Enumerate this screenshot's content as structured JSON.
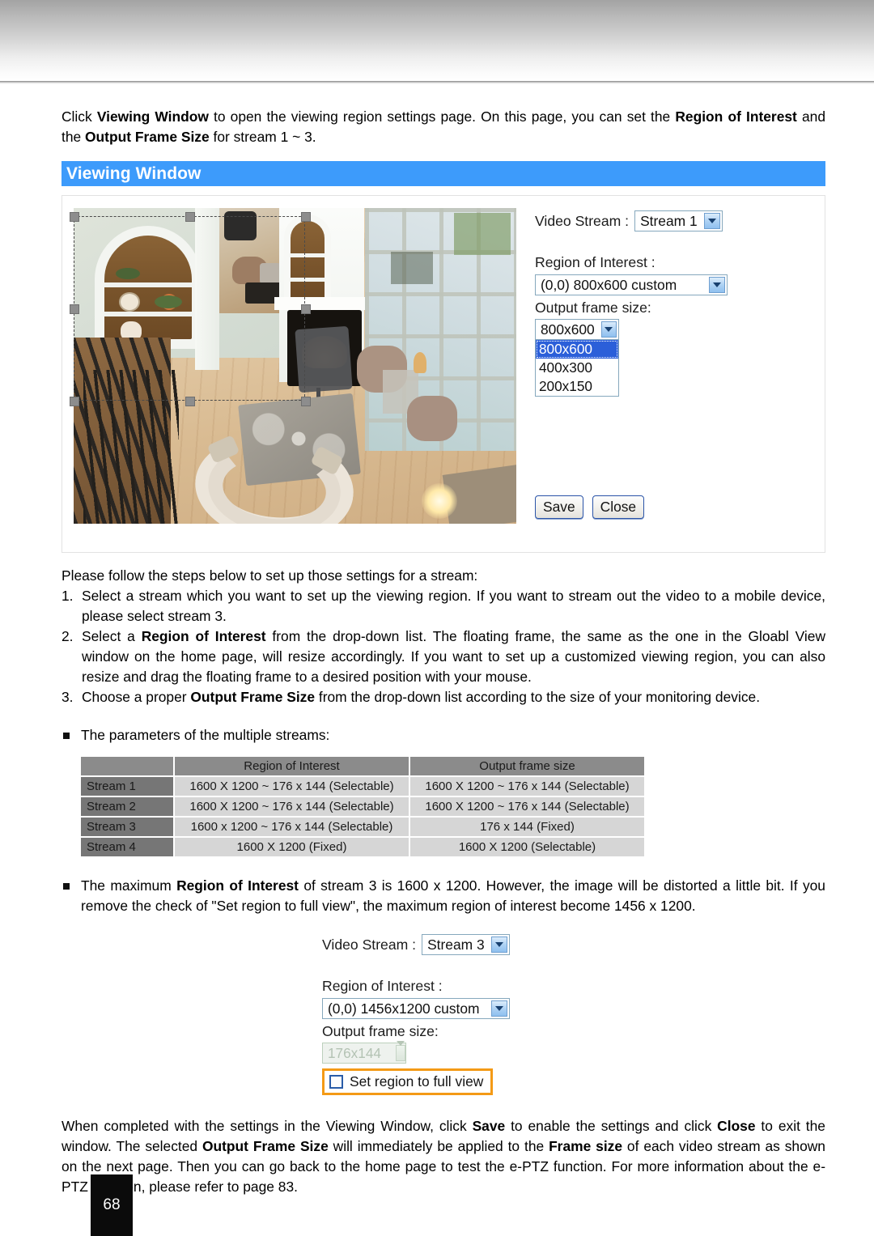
{
  "intro": {
    "paragraph_parts": [
      {
        "t": "Click ",
        "b": false
      },
      {
        "t": "Viewing Window",
        "b": true
      },
      {
        "t": " to open the viewing region settings page. On this page, you can set the ",
        "b": false
      },
      {
        "t": "Region of Interest",
        "b": true
      },
      {
        "t": " and the ",
        "b": false
      },
      {
        "t": "Output Frame Size",
        "b": true
      },
      {
        "t": " for stream 1 ~ 3.",
        "b": false
      }
    ]
  },
  "section": {
    "title": "Viewing Window",
    "accent_color": "#3d9bfb"
  },
  "panel": {
    "video_stream": {
      "label": "Video Stream :",
      "value": "Stream 1"
    },
    "region_of_interest": {
      "label": "Region of Interest :",
      "value": "(0,0) 800x600 custom"
    },
    "output_frame_size": {
      "label": "Output frame size:",
      "value": "800x600",
      "options": [
        "800x600",
        "400x300",
        "200x150"
      ],
      "selected_index": 0
    },
    "buttons": {
      "save": "Save",
      "close": "Close"
    }
  },
  "steps": {
    "intro": "Please follow the steps below to set up those settings for a stream:",
    "items": [
      {
        "num": "1.",
        "parts": [
          {
            "t": "Select a stream which you want to set up the viewing region. If you want to stream out the video to a mobile device, please select stream 3.",
            "b": false
          }
        ]
      },
      {
        "num": "2.",
        "parts": [
          {
            "t": "Select a ",
            "b": false
          },
          {
            "t": "Region of Interest",
            "b": true
          },
          {
            "t": " from the drop-down list. The floating frame, the same as the one in the Gloabl View window on the home page, will resize accordingly. If you want to set up a customized viewing region, you can also resize and drag the floating frame to a desired position with your mouse.",
            "b": false
          }
        ]
      },
      {
        "num": "3.",
        "parts": [
          {
            "t": "Choose a proper ",
            "b": false
          },
          {
            "t": "Output Frame Size",
            "b": true
          },
          {
            "t": " from the drop-down list according to the size of your monitoring device.",
            "b": false
          }
        ]
      }
    ]
  },
  "bullet_params": {
    "text": "The parameters of the multiple streams:"
  },
  "table": {
    "corner": "",
    "columns": [
      "Region of Interest",
      "Output frame size"
    ],
    "rows": [
      {
        "label": "Stream 1",
        "cells": [
          "1600 X 1200 ~ 176 x 144 (Selectable)",
          "1600 X 1200 ~ 176 x 144 (Selectable)"
        ]
      },
      {
        "label": "Stream 2",
        "cells": [
          "1600 X 1200 ~ 176 x 144 (Selectable)",
          "1600 X 1200 ~ 176 x 144 (Selectable)"
        ]
      },
      {
        "label": "Stream 3",
        "cells": [
          "1600 x 1200 ~ 176 x 144 (Selectable)",
          "176 x 144 (Fixed)"
        ]
      },
      {
        "label": "Stream 4",
        "cells": [
          "1600 X 1200 (Fixed)",
          "1600 X 1200 (Selectable)"
        ]
      }
    ]
  },
  "bullet_max_roi": {
    "parts": [
      {
        "t": "The maximum ",
        "b": false
      },
      {
        "t": "Region of Interest",
        "b": true
      },
      {
        "t": " of stream 3 is 1600 x 1200. However, the image will be distorted a little bit. If you remove the check of \"Set region to full view\", the maximum region of interest become 1456 x 1200.",
        "b": false
      }
    ]
  },
  "stream3_figure": {
    "video_stream": {
      "label": "Video Stream :",
      "value": "Stream 3"
    },
    "region_of_interest": {
      "label": "Region of Interest :",
      "value": "(0,0) 1456x1200 custom"
    },
    "output_frame_size": {
      "label": "Output frame size:",
      "value": "176x144"
    },
    "checkbox": {
      "label": "Set region to full view",
      "checked": false,
      "highlight_color": "#f49a16"
    }
  },
  "closing": {
    "parts": [
      {
        "t": "When completed with the settings in the Viewing Window, click ",
        "b": false
      },
      {
        "t": "Save",
        "b": true
      },
      {
        "t": " to enable the settings and click ",
        "b": false
      },
      {
        "t": "Close",
        "b": true
      },
      {
        "t": " to exit the window. The selected ",
        "b": false
      },
      {
        "t": "Output Frame Size",
        "b": true
      },
      {
        "t": " will immediately be applied to the ",
        "b": false
      },
      {
        "t": "Frame size",
        "b": true
      },
      {
        "t": " of each video stream as shown on the next page. Then you can go back to the home page to test the e-PTZ function. For more information about the e-PTZ function, please refer to page 83.",
        "b": false
      }
    ]
  },
  "footer": {
    "page_number": "68"
  }
}
